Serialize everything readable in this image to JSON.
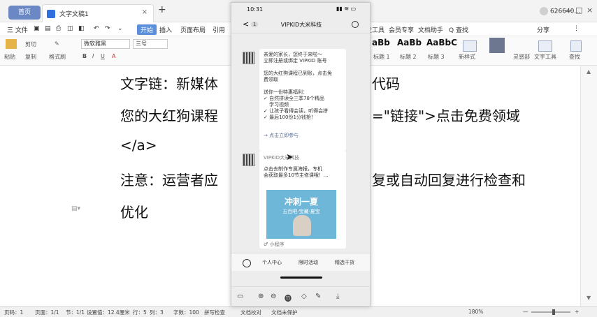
{
  "titlebar": {
    "home_tab": "首页",
    "doc_tab": "文字文稿1",
    "doc_close": "×",
    "add_tab": "+",
    "user": "626640...",
    "minimize": "—",
    "maximize": "□",
    "close": "×"
  },
  "menubar": {
    "file": "三 文件",
    "start": "开始",
    "insert": "插入",
    "page_layout": "页面布局",
    "references": "引用",
    "devtools": "开发工具",
    "member": "会员专享",
    "doc_assistant": "文档助手",
    "search": "Q 查找",
    "share": "分享",
    "more": "⋮"
  },
  "toolbar": {
    "paste": "粘贴",
    "cut": "剪切",
    "copy": "复制",
    "format_painter": "格式刷",
    "font": "微软雅黑",
    "size": "三号",
    "styles": [
      {
        "sample": "aBb",
        "name": "标题 1"
      },
      {
        "sample": "AaBb",
        "name": "标题 2"
      },
      {
        "sample": "AaBbC",
        "name": "标题 3"
      }
    ],
    "new_style": "新样式",
    "inspiration": "灵感部",
    "text_tools": "文字工具",
    "find_replace": "查找"
  },
  "document": {
    "line1_left": "文字链：新媒体",
    "line1_right": "代码",
    "line2_left": "您的大红狗课程",
    "line2_right": "=\"链接\">点击免费领域",
    "line3": "</a>",
    "line4_left": "注意：运营者应",
    "line4_right": "复或自动回复进行检查和",
    "line5": "优化"
  },
  "phone": {
    "time": "10:31",
    "status_icons": "▮▮ ≋ ▭",
    "back": "<",
    "badge": "1",
    "title": "VIPKID大米科技",
    "msg1": [
      "亲爱的家长，您终于来啦～",
      "立即注册或绑定 VIPKID 账号",
      "",
      "您的大红狗课程已到账，点击免",
      "费领取",
      "",
      "送你一份特惠福利：",
      "✓ 自然拼读全三季78个精品",
      "学习视频",
      "✓ 让孩子看得会读，听得会拼",
      "✓ 最后100份1分钱抢！",
      "",
      "→ 点击立即参与"
    ],
    "msg2_header": "VIPKID大米科技",
    "msg2_lines": [
      "点击去制作专属海报，专机",
      "会获取最多10节主修课哦！..."
    ],
    "promo_text": "冲刺一夏",
    "promo_sub": "五百吧·宝藏·夏宝",
    "mini_program": "♂ 小程序",
    "menu": [
      "个人中心",
      "限时活动",
      "精选干货"
    ],
    "bottom_icons": [
      "▭",
      "⊕",
      "⊖",
      "⓫",
      "◇",
      "✎",
      "⤓"
    ]
  },
  "statusbar": {
    "page": "页码：1",
    "pages": "页面：1/1",
    "section": "节：1/1",
    "setting": "设置值：12.4厘米",
    "row": "行：5",
    "col": "列：3",
    "words": "字数：100",
    "spellcheck": "拼写检查",
    "proofread": "文档校对",
    "protect": "文档未保护",
    "zoom": "180%",
    "zoom_out": "—",
    "zoom_in": "+"
  }
}
